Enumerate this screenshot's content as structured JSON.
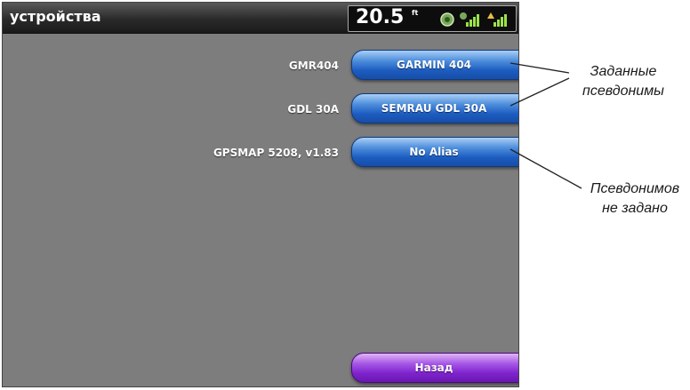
{
  "titlebar": {
    "title": "устройства",
    "depth_value": "20.5",
    "depth_unit": "ft"
  },
  "devices": [
    {
      "name": "GMR404",
      "alias": "GARMIN 404"
    },
    {
      "name": "GDL 30A",
      "alias": "SEMRAU GDL 30A"
    },
    {
      "name": "GPSMAP 5208, v1.83",
      "alias": "No Alias"
    }
  ],
  "back_button": {
    "label": "Назад"
  },
  "callouts": {
    "aliases_set": {
      "line1": "Заданные",
      "line2": "псевдонимы"
    },
    "no_aliases": {
      "line1": "Псевдонимов",
      "line2": "не задано"
    }
  },
  "colors": {
    "alias_button": "#2a6bcc",
    "back_button": "#8a2ed6",
    "screen_bg": "#7d7d7d"
  },
  "icons": [
    "gps-fix-icon",
    "signal-strength-icon",
    "signal-strength-alt-icon"
  ]
}
